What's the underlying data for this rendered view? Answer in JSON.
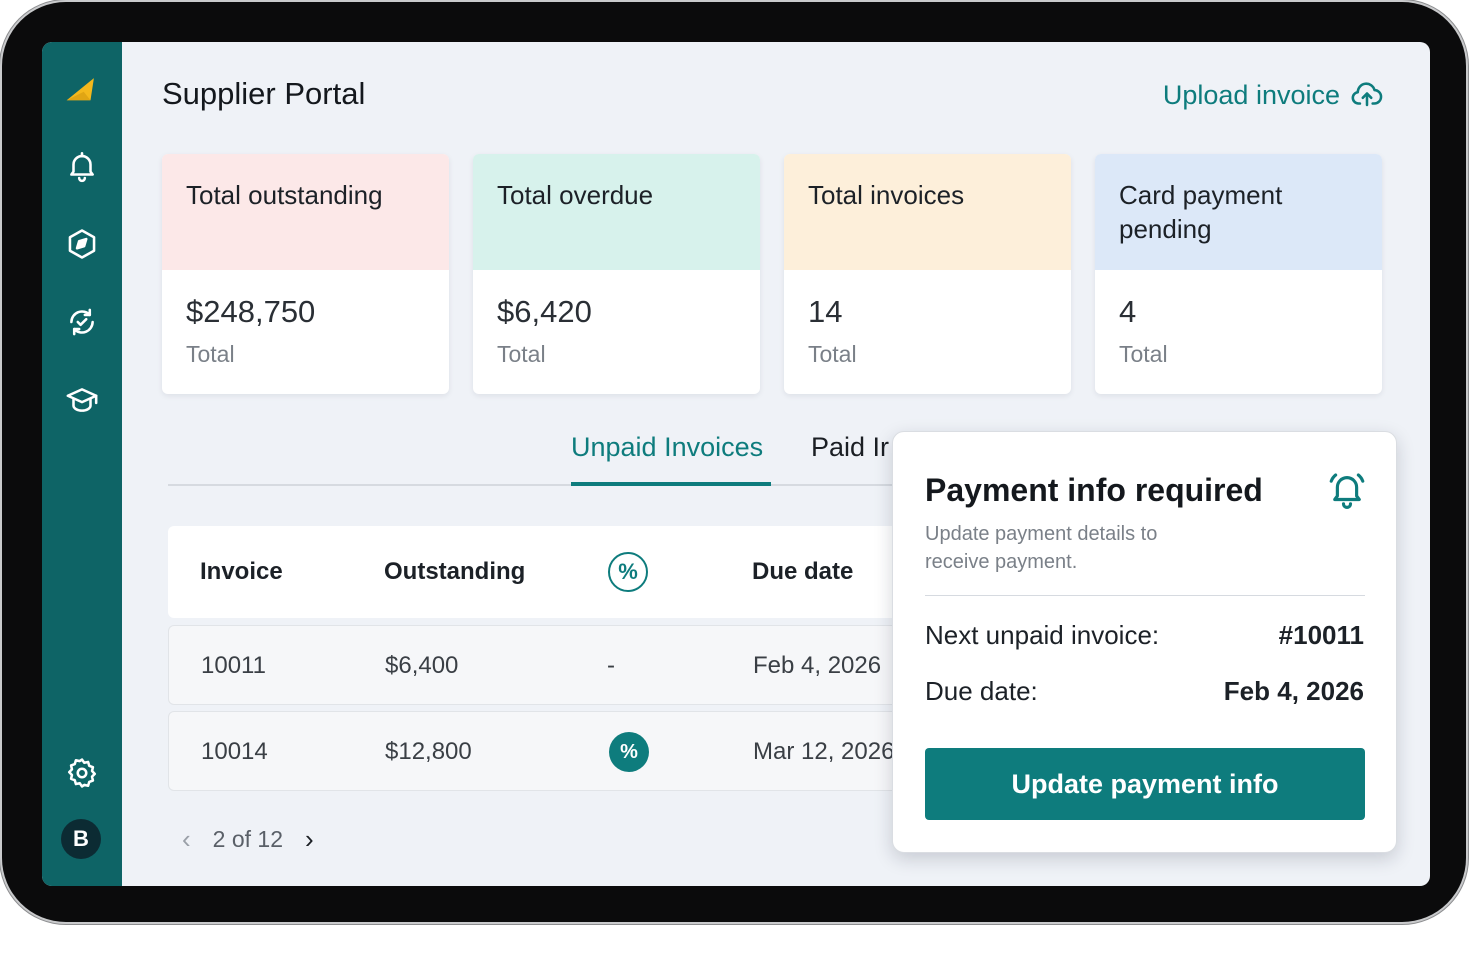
{
  "app": {
    "title": "Supplier Portal"
  },
  "header": {
    "upload_label": "Upload invoice",
    "upload_icon": "cloud-upload-icon"
  },
  "sidebar": {
    "logo_icon": "brand-logo",
    "items": [
      {
        "icon": "bell-icon"
      },
      {
        "icon": "compass-icon"
      },
      {
        "icon": "sync-icon"
      },
      {
        "icon": "graduation-cap-icon"
      },
      {
        "icon": "gear-icon"
      }
    ],
    "avatar_initial": "B"
  },
  "cards": [
    {
      "title": "Total outstanding",
      "value": "$248,750",
      "sub": "Total",
      "color": "#fce8e8"
    },
    {
      "title": "Total overdue",
      "value": "$6,420",
      "sub": "Total",
      "color": "#d7f2ec"
    },
    {
      "title": "Total invoices",
      "value": "14",
      "sub": "Total",
      "color": "#fdefda"
    },
    {
      "title": "Card payment pending",
      "value": "4",
      "sub": "Total",
      "color": "#dce8f8"
    }
  ],
  "tabs": [
    {
      "label": "Unpaid Invoices",
      "active": true
    },
    {
      "label": "Paid Ir",
      "active": false
    }
  ],
  "table": {
    "columns": [
      "Invoice",
      "Outstanding",
      "%",
      "Due date"
    ],
    "rows": [
      {
        "invoice": "10011",
        "outstanding": "$6,400",
        "discount": "-",
        "due": "Feb 4, 2026"
      },
      {
        "invoice": "10014",
        "outstanding": "$12,800",
        "discount": "%",
        "due": "Mar 12, 2026"
      }
    ]
  },
  "pagination": {
    "label": "2 of 12"
  },
  "popover": {
    "title": "Payment info required",
    "subtitle": "Update payment details to receive payment.",
    "next_label": "Next unpaid invoice:",
    "next_value": "#10011",
    "due_label": "Due date:",
    "due_value": "Feb 4, 2026",
    "button_label": "Update payment info",
    "icon": "bell-ring-icon"
  },
  "colors": {
    "primary": "#0e7c7d",
    "sidebar": "#0e6466",
    "logo": "#f4b81c"
  }
}
